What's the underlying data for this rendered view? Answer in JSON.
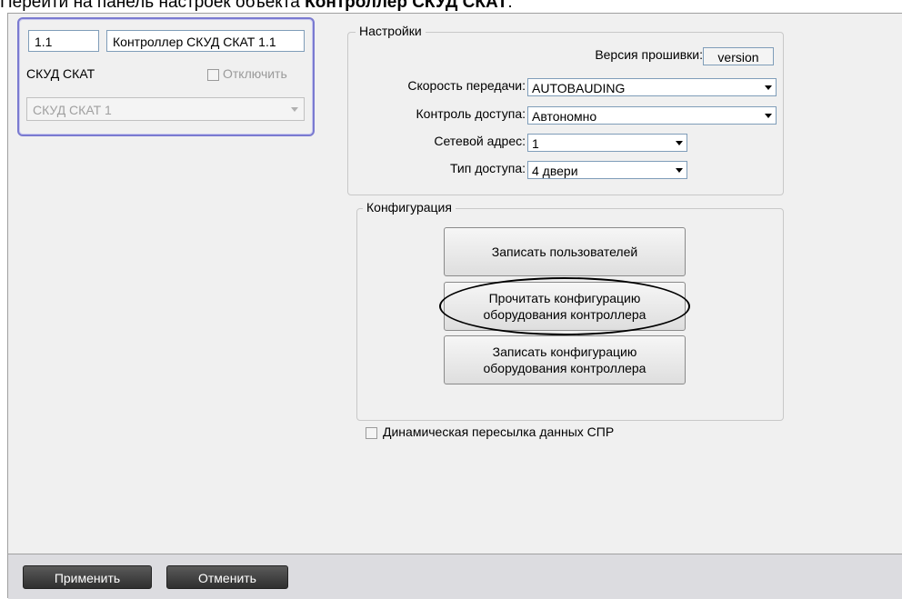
{
  "caption": {
    "prefix": "Перейти на панель настроек объекта ",
    "bold": "Контроллер СКУД СКАТ",
    "suffix": "."
  },
  "object_panel": {
    "id_value": "1.1",
    "name_value": "Контроллер СКУД СКАТ 1.1",
    "parent_label": "СКУД СКАТ",
    "disable_label": "Отключить",
    "disable_checked": false,
    "parent_select_value": "СКУД СКАТ 1"
  },
  "settings": {
    "title": "Настройки",
    "firmware_label": "Версия прошивки:",
    "firmware_value": "version",
    "baud_label": "Скорость передачи:",
    "baud_value": "AUTOBAUDING",
    "access_control_label": "Контроль доступа:",
    "access_control_value": "Автономно",
    "network_address_label": "Сетевой адрес:",
    "network_address_value": "1",
    "access_type_label": "Тип доступа:",
    "access_type_value": "4 двери"
  },
  "configuration": {
    "title": "Конфигурация",
    "write_users_label": "Записать пользователей",
    "read_config_line1": "Прочитать конфигурацию",
    "read_config_line2": "оборудования контроллера",
    "write_config_line1": "Записать  конфигурацию",
    "write_config_line2": "оборудования контроллера"
  },
  "dynamic_forward": {
    "label": "Динамическая пересылка данных СПР",
    "checked": false
  },
  "bottom": {
    "apply_label": "Применить",
    "cancel_label": "Отменить"
  },
  "colors": {
    "panel_border": "#7a7ad0",
    "bottom_bar": "#dcdce0",
    "bottom_button": "#3a3a3a"
  }
}
